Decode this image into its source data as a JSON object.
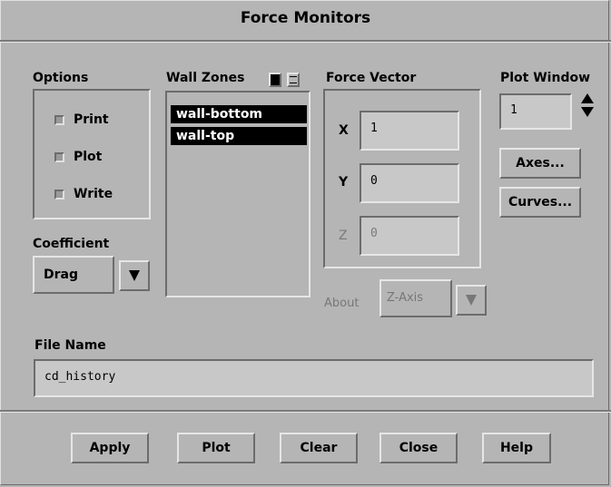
{
  "window": {
    "title": "Force Monitors"
  },
  "options": {
    "label": "Options",
    "items": [
      {
        "label": "Print"
      },
      {
        "label": "Plot"
      },
      {
        "label": "Write"
      }
    ]
  },
  "coefficient": {
    "label": "Coefficient",
    "value": "Drag"
  },
  "wall_zones": {
    "label": "Wall Zones",
    "items": [
      "wall-bottom",
      "wall-top"
    ]
  },
  "force_vector": {
    "label": "Force Vector",
    "x_label": "X",
    "x_value": "1",
    "y_label": "Y",
    "y_value": "0",
    "z_label": "Z",
    "z_value": "0",
    "about_label": "About",
    "about_value": "Z-Axis"
  },
  "plot_window": {
    "label": "Plot Window",
    "value": "1",
    "axes_button": "Axes...",
    "curves_button": "Curves..."
  },
  "file_name": {
    "label": "File Name",
    "value": "cd_history"
  },
  "buttons": {
    "apply": "Apply",
    "plot": "Plot",
    "clear": "Clear",
    "close": "Close",
    "help": "Help"
  }
}
